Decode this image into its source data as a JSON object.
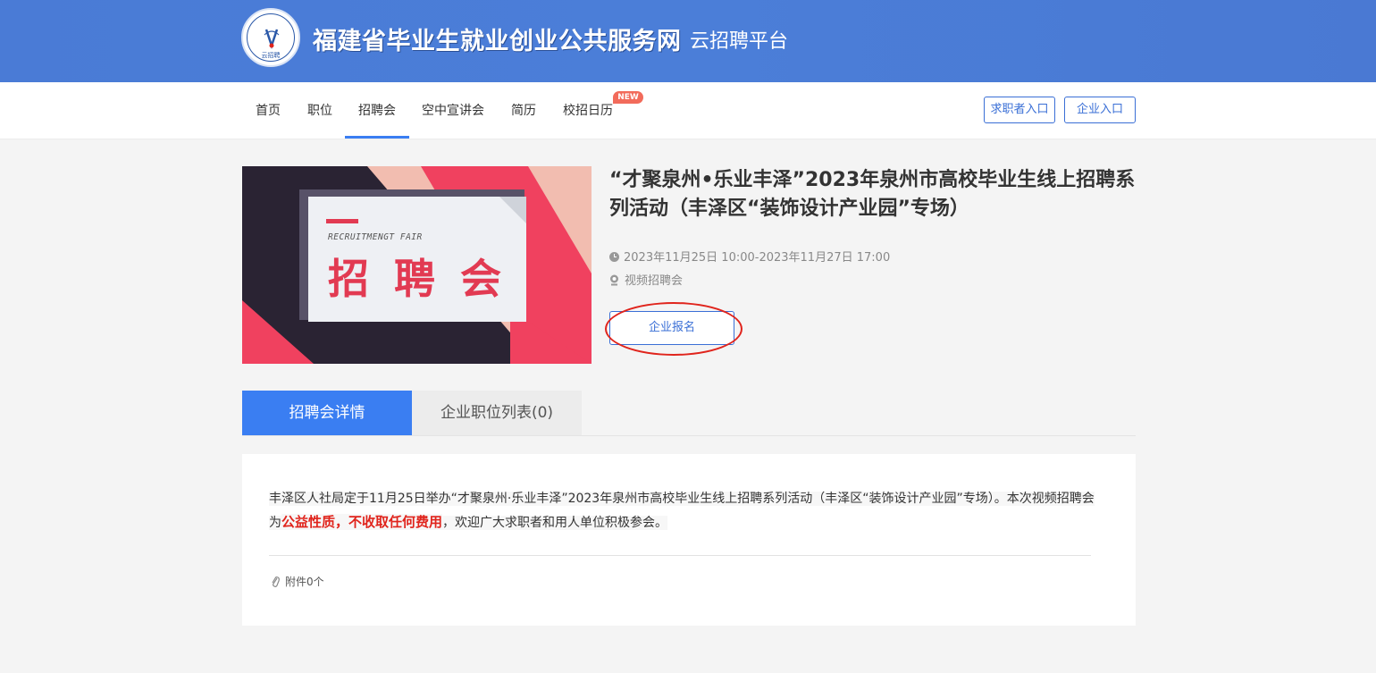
{
  "header": {
    "logo_caption": "云招聘",
    "site_title": "福建省毕业生就业创业公共服务网",
    "site_subtitle": "云招聘平台"
  },
  "nav": {
    "items": [
      {
        "label": "首页"
      },
      {
        "label": "职位"
      },
      {
        "label": "招聘会",
        "active": true
      },
      {
        "label": "空中宣讲会"
      },
      {
        "label": "简历"
      },
      {
        "label": "校招日历",
        "badge": "NEW"
      }
    ],
    "jobseeker_entry": "求职者入口",
    "company_entry": "企业入口"
  },
  "poster": {
    "subtitle": "RECRUITMENGT FAIR",
    "title": "招 聘 会"
  },
  "fair": {
    "title": "“才聚泉州•乐业丰泽”2023年泉州市高校毕业生线上招聘系列活动（丰泽区“装饰设计产业园”专场）",
    "time": "2023年11月25日 10:00-2023年11月27日 17:00",
    "type": "视频招聘会",
    "register_label": "企业报名"
  },
  "tabs": {
    "detail": "招聘会详情",
    "jobs": "企业职位列表(0)"
  },
  "detail": {
    "text_before": "丰泽区人社局定于11月25日举办“才聚泉州·乐业丰泽”2023年泉州市高校毕业生线上招聘系列活动（丰泽区“装饰设计产业园”专场）。本次视频招聘会为",
    "text_emphasis": "公益性质，不收取任何费用",
    "text_after": "，欢迎广大求职者和用人单位积极参会。",
    "attachments": "附件0个"
  },
  "colors": {
    "banner": "#4a7bd6",
    "accent": "#3a7ef2",
    "highlight_red": "#e0241c",
    "badge": "#f26b5b"
  },
  "icons": [
    "clock-icon",
    "video-icon",
    "paperclip-icon",
    "site-logo"
  ]
}
